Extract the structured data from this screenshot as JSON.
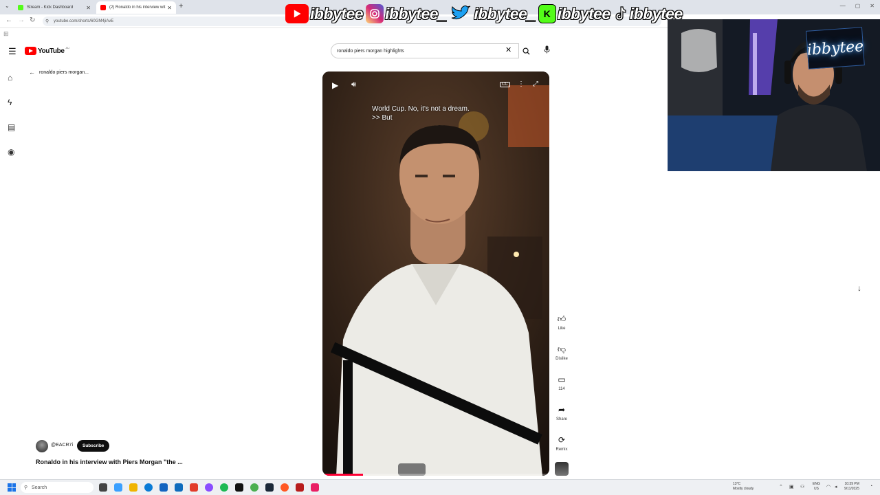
{
  "browser": {
    "tabs": [
      {
        "title": "Stream - Kick Dashboard",
        "favicon_color": "#53fc18"
      },
      {
        "title": "(2) Ronaldo in his interview wit",
        "favicon_color": "#ff0000"
      }
    ],
    "url": "youtube.com/shorts/60GM4jiAvE"
  },
  "overlay": {
    "handles": [
      {
        "platform": "youtube-icon",
        "handle": "ibbytee",
        "color": "#ff0000"
      },
      {
        "platform": "instagram-icon",
        "handle": "ibbytee_",
        "color": "#d62976"
      },
      {
        "platform": "twitter-icon",
        "handle": "ibbytee_",
        "color": "#1da1f2"
      },
      {
        "platform": "kick-icon",
        "handle": "ibbytee",
        "color": "#53fc18"
      },
      {
        "platform": "tiktok-icon",
        "handle": "ibbytee",
        "color": "#111111"
      }
    ],
    "webcam_sign": "ibbytee"
  },
  "youtube": {
    "logo_text": "YouTube",
    "country_code": "AU",
    "search": {
      "query": "ronaldo piers morgan highlights"
    },
    "back_label": "ronaldo piers morgan...",
    "video": {
      "caption_lines": [
        "World Cup. No, it's not a dream.",
        ">> But"
      ],
      "cc_label": "CC",
      "progress": 0.18
    },
    "actions": [
      {
        "icon": "like-icon",
        "label": "Like"
      },
      {
        "icon": "dislike-icon",
        "label": "Dislike"
      },
      {
        "icon": "comment-icon",
        "label": "114"
      },
      {
        "icon": "share-icon",
        "label": "Share"
      },
      {
        "icon": "remix-icon",
        "label": "Remix"
      }
    ],
    "channel": {
      "name": "@EACR7i",
      "subscribe_label": "Subscribe"
    },
    "video_title": "Ronaldo in his interview with Piers Morgan \"the ..."
  },
  "taskbar": {
    "search_placeholder": "Search",
    "weather": {
      "temp": "13°C",
      "desc": "Mostly cloudy"
    },
    "lang": {
      "line1": "ENG",
      "line2": "US"
    },
    "clock": {
      "time": "10:39 PM",
      "date": "9/11/2025"
    }
  },
  "colors": {
    "accent": "#ff0000",
    "subscribe_bg": "#0f0f0f"
  }
}
